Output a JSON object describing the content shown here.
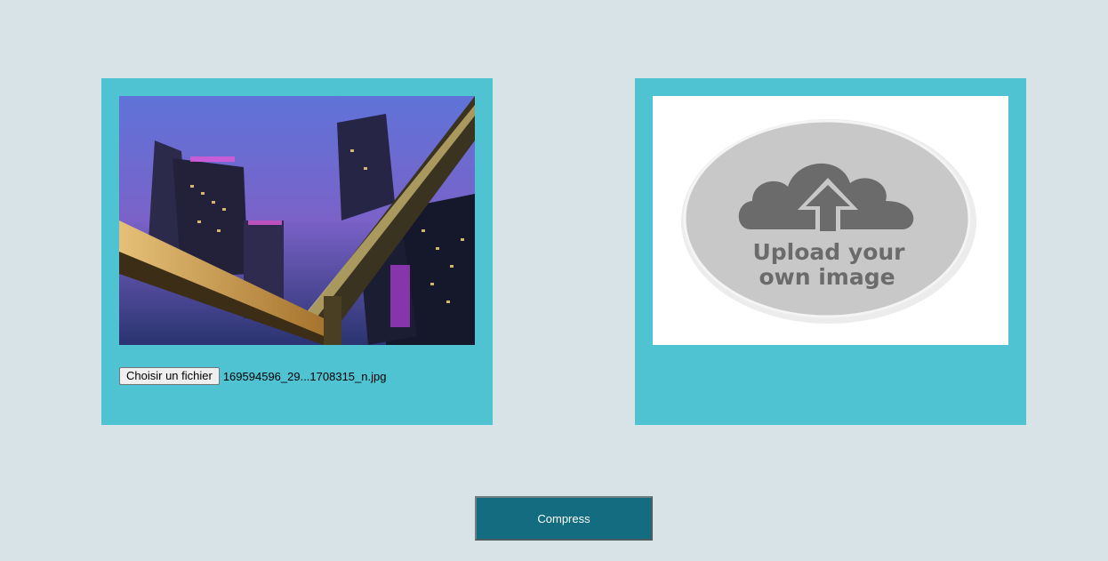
{
  "left_panel": {
    "image_alt": "city-skyline-photo",
    "file_button_label": "Choisir un fichier",
    "file_name": "169594596_29...1708315_n.jpg"
  },
  "right_panel": {
    "placeholder_line1": "Upload your",
    "placeholder_line2": "own image"
  },
  "compress_button_label": "Compress",
  "colors": {
    "page_background": "#d8e3e8",
    "panel_background": "#50c3d3",
    "button_background": "#136c80"
  }
}
